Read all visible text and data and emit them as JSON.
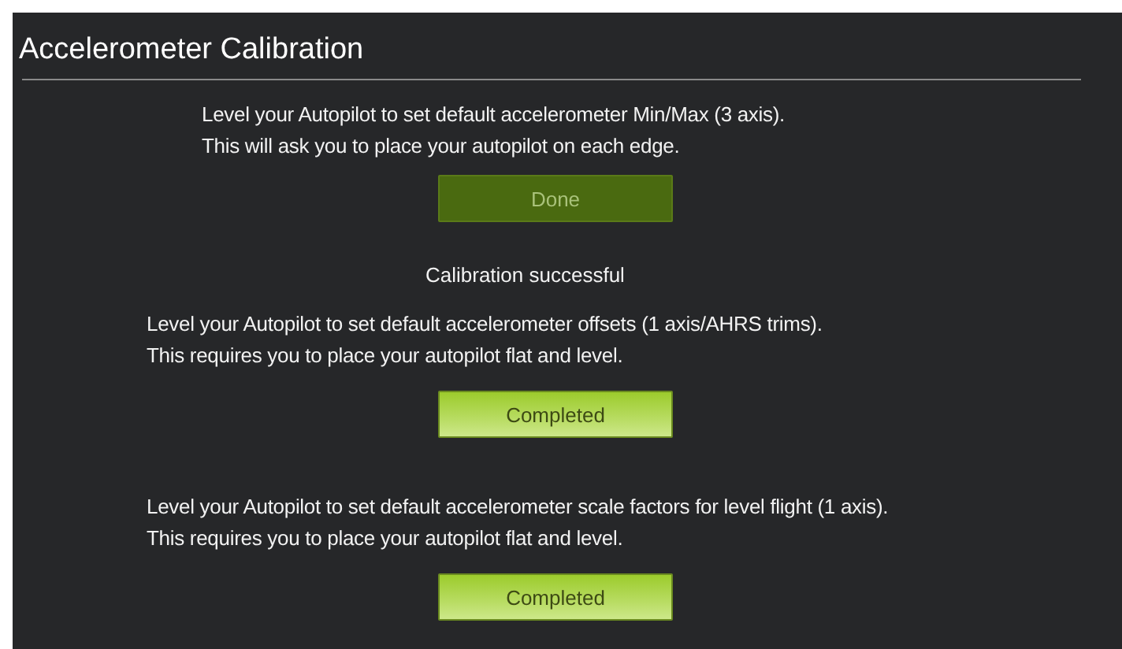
{
  "title": "Accelerometer Calibration",
  "sections": [
    {
      "lines": [
        "Level your Autopilot to set default accelerometer Min/Max (3 axis).",
        "This will ask you to place your autopilot on each edge."
      ],
      "button": {
        "label": "Done",
        "disabled": true
      },
      "status": "Calibration successful"
    },
    {
      "lines": [
        "Level your Autopilot to set default accelerometer offsets (1 axis/AHRS trims).",
        "This requires you to place your autopilot flat and level."
      ],
      "button": {
        "label": "Completed",
        "disabled": false
      }
    },
    {
      "lines": [
        "Level your Autopilot to set default accelerometer scale factors for level flight (1 axis).",
        "This requires you to place your autopilot flat and level."
      ],
      "button": {
        "label": "Completed",
        "disabled": false
      }
    }
  ]
}
